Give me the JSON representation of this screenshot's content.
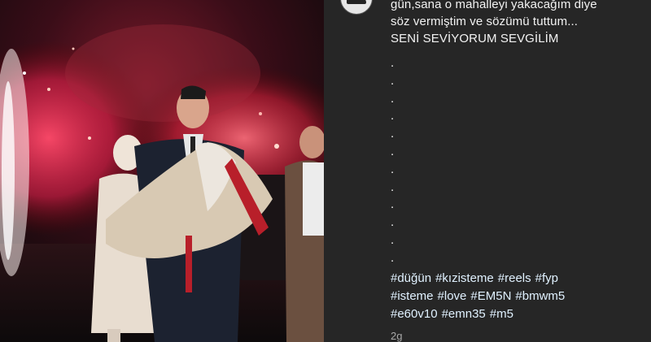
{
  "post": {
    "caption_lines": [
      "gün,sana o mahalleyi yakacağım diye",
      "söz vermiştim ve sözümü tuttum...",
      "SENİ SEVİYORUM SEVGİLİM"
    ],
    "dots": [
      ".",
      ".",
      ".",
      ".",
      ".",
      ".",
      ".",
      ".",
      ".",
      ".",
      ".",
      "."
    ],
    "hashtag_rows": [
      [
        "#düğün",
        "#kızisteme",
        "#reels",
        "#fyp"
      ],
      [
        "#isteme",
        "#love",
        "#EM5N",
        "#bmwm5"
      ],
      [
        "#e60v10",
        "#emn35",
        "#m5"
      ]
    ],
    "timestamp": "2g"
  },
  "colors": {
    "panel_bg": "#262626",
    "hashtag": "#e0f1ff",
    "text": "#f2f2f2",
    "timestamp": "#a8a8a8"
  },
  "icons": {
    "avatar": "profile-avatar-car-icon"
  }
}
